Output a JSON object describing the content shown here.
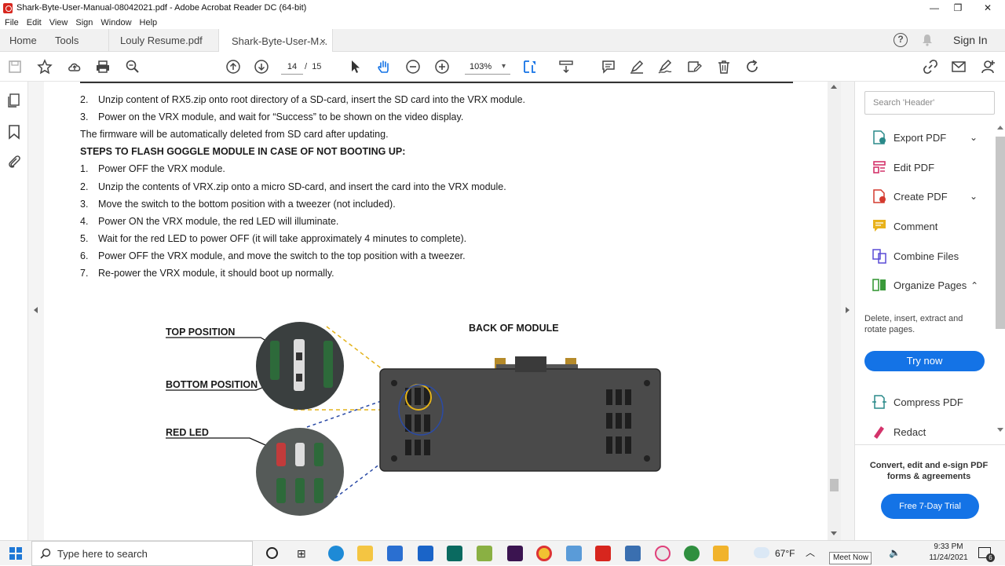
{
  "window": {
    "title": "Shark-Byte-User-Manual-08042021.pdf - Adobe Acrobat Reader DC (64-bit)"
  },
  "menu": [
    "File",
    "Edit",
    "View",
    "Sign",
    "Window",
    "Help"
  ],
  "tabs": {
    "home": "Home",
    "tools": "Tools",
    "doc1": "Louly Resume.pdf",
    "doc2": "Shark-Byte-User-M...",
    "close": "×"
  },
  "header_right": {
    "sign_in": "Sign In"
  },
  "toolbar": {
    "page_current": "14",
    "page_sep": "/",
    "page_total": "15",
    "zoom": "103%"
  },
  "document": {
    "lines_top": [
      {
        "num": "2.",
        "text": "Unzip content of RX5.zip onto root directory of a SD-card, insert the SD card into the VRX module."
      },
      {
        "num": "3.",
        "text": "Power on the VRX module, and wait for “Success” to be shown on the video display."
      }
    ],
    "note": "The firmware will be automatically deleted from SD card after updating.",
    "heading": "STEPS TO FLASH GOGGLE MODULE IN CASE OF NOT BOOTING UP:",
    "steps": [
      {
        "num": "1.",
        "text": "Power OFF the VRX module."
      },
      {
        "num": "2.",
        "text": "Unzip the contents of VRX.zip onto a micro SD-card, and insert the card into the VRX module."
      },
      {
        "num": "3.",
        "text": "Move the switch to the bottom position with a tweezer (not included)."
      },
      {
        "num": "4.",
        "text": "Power ON the VRX module, the red LED will illuminate."
      },
      {
        "num": "5.",
        "text": "Wait for the red LED to power OFF (it will take approximately 4 minutes to complete)."
      },
      {
        "num": "6.",
        "text": "Power OFF the VRX module, and move the switch to the top position with a tweezer."
      },
      {
        "num": "7.",
        "text": "Re-power the VRX module, it should boot up normally."
      }
    ],
    "figure": {
      "top_position": "TOP POSITION",
      "bottom_position": "BOTTOM POSITION",
      "red_led": "RED LED",
      "back_of_module": "BACK OF MODULE"
    }
  },
  "right_pane": {
    "search_placeholder": "Search 'Header'",
    "tools": [
      {
        "label": "Export PDF",
        "color": "#2a8a8a"
      },
      {
        "label": "Edit PDF",
        "color": "#d4336b"
      },
      {
        "label": "Create PDF",
        "color": "#d43a2f"
      },
      {
        "label": "Comment",
        "color": "#e8b21c"
      },
      {
        "label": "Combine Files",
        "color": "#5a4bd6"
      },
      {
        "label": "Organize Pages",
        "color": "#3a9a3a"
      }
    ],
    "organize_desc": "Delete, insert, extract and rotate pages.",
    "try_now": "Try now",
    "tools2": [
      {
        "label": "Compress PDF",
        "color": "#2a8a8a"
      },
      {
        "label": "Redact",
        "color": "#d4336b"
      }
    ],
    "promo": "Convert, edit and e-sign PDF forms & agreements",
    "trial": "Free 7-Day Trial"
  },
  "taskbar": {
    "search_placeholder": "Type here to search",
    "weather": "67°F",
    "time": "9:33 PM",
    "date": "11/24/2021",
    "tooltip": "Meet Now",
    "notif_count": "6"
  },
  "colors": {
    "accent": "#1473e6",
    "pdf_red": "#d7261e"
  }
}
